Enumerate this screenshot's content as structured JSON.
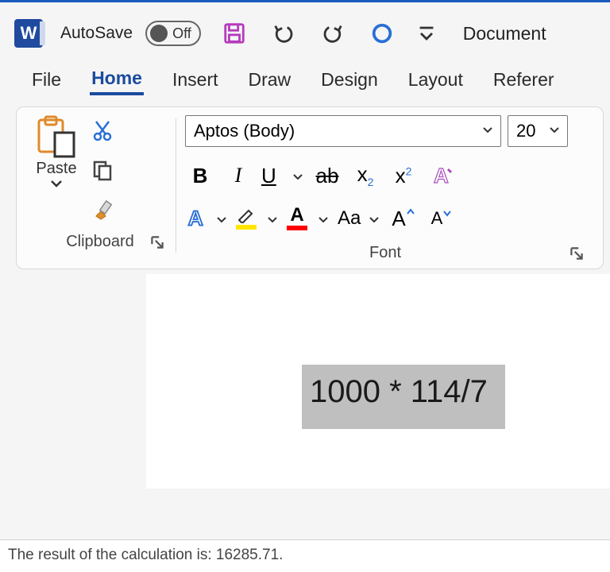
{
  "titlebar": {
    "app_initial": "W",
    "autosave_label": "AutoSave",
    "autosave_state": "Off",
    "document_title": "Document"
  },
  "tabs": {
    "file": "File",
    "home": "Home",
    "insert": "Insert",
    "draw": "Draw",
    "design": "Design",
    "layout": "Layout",
    "references": "Referer"
  },
  "ribbon": {
    "clipboard": {
      "paste": "Paste",
      "group_label": "Clipboard"
    },
    "font": {
      "name": "Aptos (Body)",
      "size": "20",
      "bold": "B",
      "italic": "I",
      "underline": "U",
      "strike": "ab",
      "subscript": "x",
      "subscript_sub": "2",
      "superscript": "x",
      "superscript_sup": "2",
      "text_effects": "A",
      "highlight": "A",
      "font_color": "A",
      "change_case": "Aa",
      "grow": "A",
      "shrink": "A",
      "group_label": "Font"
    }
  },
  "document": {
    "selected_text": "1000 * 114/7"
  },
  "statusbar": {
    "text": "The result of the calculation is: 16285.71."
  },
  "colors": {
    "accent": "#1b4b9e",
    "highlight": "#ffe600",
    "font_color": "#ff0000",
    "save_icon": "#b53bbd",
    "coach_ring": "#2a6fd6"
  }
}
